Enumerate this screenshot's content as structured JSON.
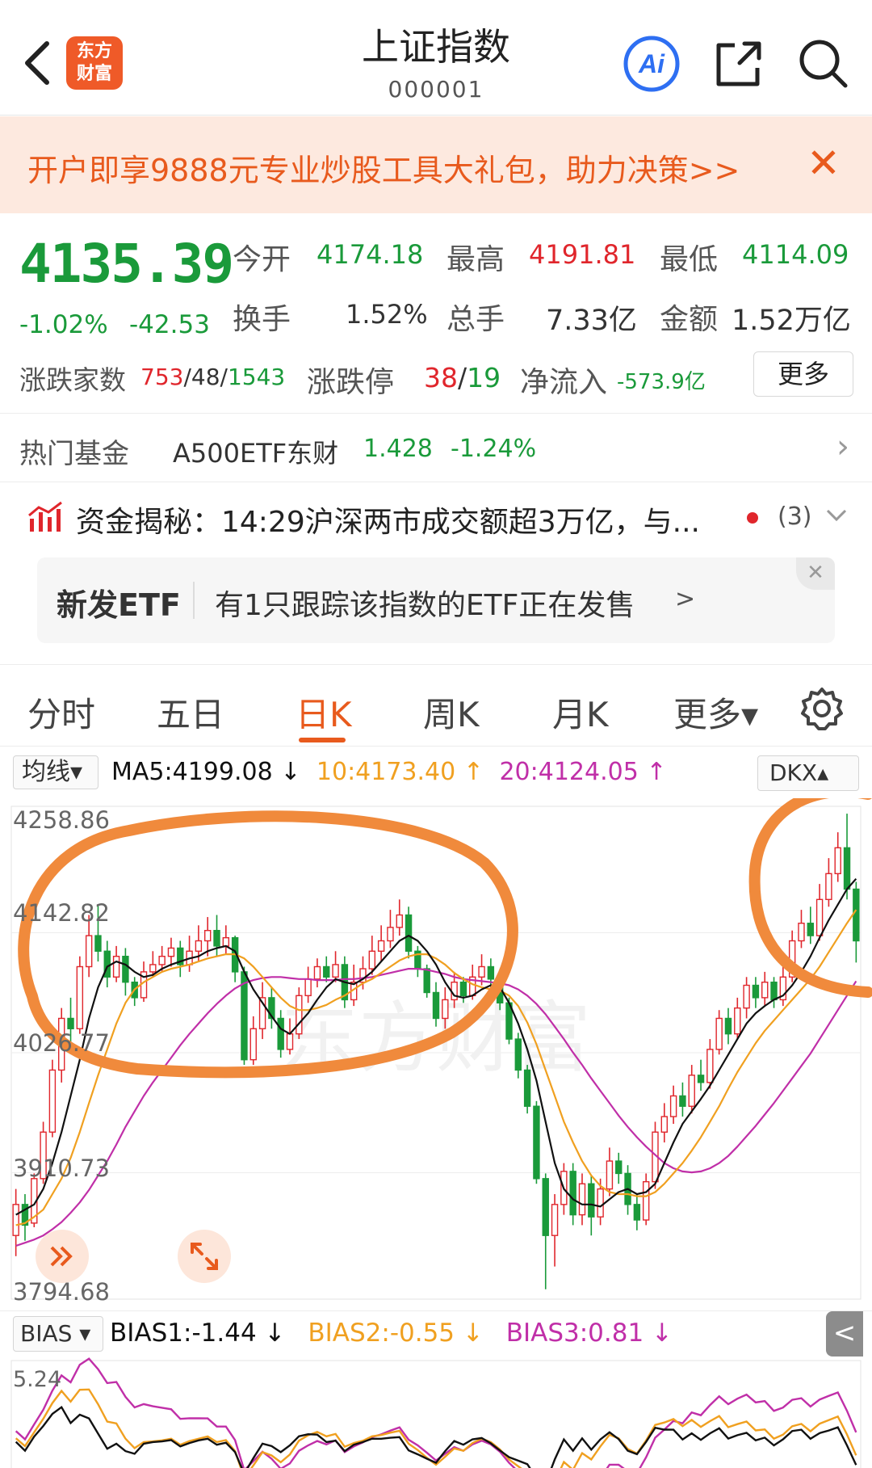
{
  "header": {
    "logo": [
      "东方",
      "财富"
    ],
    "title": "上证指数",
    "code": "000001"
  },
  "promo": {
    "text": "开户即享9888元专业炒股工具大礼包，助力决策>>",
    "close": "✕"
  },
  "quote": {
    "price": "4135.39",
    "pct": "-1.02%",
    "chg": "-42.53",
    "open_label": "今开",
    "open": "4174.18",
    "high_label": "最高",
    "high": "4191.81",
    "low_label": "最低",
    "low": "4114.09",
    "turnover_label": "换手",
    "turnover": "1.52%",
    "volume_label": "总手",
    "volume": "7.33亿",
    "amount_label": "金额",
    "amount": "1.52万亿",
    "breadth_label": "涨跌家数",
    "up": "753",
    "flat": "48",
    "down": "1543",
    "limit_label": "涨跌停",
    "limit_up": "38",
    "limit_down": "19",
    "inflow_label": "净流入",
    "inflow": "-573.9亿",
    "more": "更多"
  },
  "fund": {
    "label": "热门基金",
    "name": "A500ETF东财",
    "price": "1.428",
    "chg": "-1.24%"
  },
  "news": {
    "text": "资金揭秘：14:29沪深两市成交额超3万亿，与...",
    "count": "(3)"
  },
  "etf": {
    "tag": "新发ETF",
    "text": "有1只跟踪该指数的ETF正在发售",
    "arrow": ">",
    "close": "✕"
  },
  "tabs": [
    "分时",
    "五日",
    "日K",
    "周K",
    "月K",
    "更多▾"
  ],
  "active_tab": "日K",
  "ma": {
    "select": "均线▾",
    "ma5": "MA5:4199.08 ↓",
    "ma10": "10:4173.40 ↑",
    "ma20": "20:4124.05 ↑",
    "dk": "DKX▴"
  },
  "y_axis": [
    "4258.86",
    "4142.82",
    "4026.77",
    "3910.73",
    "3794.68"
  ],
  "bias": {
    "select": "BIAS ▾",
    "b1": "BIAS1:-1.44 ↓",
    "b2": "BIAS2:-0.55 ↓",
    "b3": "BIAS3:0.81 ↓",
    "top": "5.24",
    "collapse": "<"
  },
  "watermark": "东方财富",
  "colors": {
    "up": "#e0262c",
    "down": "#1a9a3a",
    "ma5": "#111111",
    "ma10": "#f0a020",
    "ma20": "#c02fa8",
    "accent": "#e85a1d",
    "annotation": "#f08a3c"
  },
  "chart_data": {
    "type": "candlestick",
    "y_range": [
      3794.68,
      4258.86
    ],
    "candles": [
      [
        3850,
        3880,
        3830,
        3895
      ],
      [
        3880,
        3860,
        3845,
        3890
      ],
      [
        3862,
        3905,
        3858,
        3910
      ],
      [
        3905,
        3950,
        3900,
        3960
      ],
      [
        3950,
        4010,
        3945,
        4020
      ],
      [
        4010,
        4060,
        3998,
        4070
      ],
      [
        4060,
        4050,
        4035,
        4080
      ],
      [
        4050,
        4110,
        4045,
        4120
      ],
      [
        4110,
        4140,
        4100,
        4160
      ],
      [
        4140,
        4125,
        4115,
        4170
      ],
      [
        4125,
        4100,
        4090,
        4135
      ],
      [
        4100,
        4120,
        4095,
        4130
      ],
      [
        4120,
        4095,
        4082,
        4128
      ],
      [
        4095,
        4080,
        4072,
        4100
      ],
      [
        4080,
        4105,
        4076,
        4115
      ],
      [
        4105,
        4112,
        4100,
        4125
      ],
      [
        4112,
        4120,
        4105,
        4130
      ],
      [
        4120,
        4128,
        4110,
        4138
      ],
      [
        4128,
        4112,
        4100,
        4135
      ],
      [
        4112,
        4125,
        4105,
        4140
      ],
      [
        4125,
        4135,
        4115,
        4150
      ],
      [
        4135,
        4145,
        4120,
        4158
      ],
      [
        4145,
        4130,
        4120,
        4160
      ],
      [
        4130,
        4138,
        4122,
        4150
      ],
      [
        4138,
        4105,
        4095,
        4140
      ],
      [
        4105,
        4020,
        4015,
        4110
      ],
      [
        4020,
        4050,
        4015,
        4062
      ],
      [
        4050,
        4080,
        4040,
        4095
      ],
      [
        4080,
        4060,
        4050,
        4090
      ],
      [
        4060,
        4030,
        4022,
        4068
      ],
      [
        4030,
        4045,
        4025,
        4060
      ],
      [
        4045,
        4082,
        4040,
        4090
      ],
      [
        4082,
        4098,
        4075,
        4110
      ],
      [
        4098,
        4110,
        4090,
        4118
      ],
      [
        4110,
        4100,
        4095,
        4120
      ],
      [
        4100,
        4112,
        4095,
        4125
      ],
      [
        4112,
        4078,
        4070,
        4120
      ],
      [
        4078,
        4095,
        4072,
        4112
      ],
      [
        4095,
        4108,
        4088,
        4120
      ],
      [
        4108,
        4125,
        4102,
        4140
      ],
      [
        4125,
        4135,
        4115,
        4150
      ],
      [
        4135,
        4148,
        4128,
        4165
      ],
      [
        4148,
        4160,
        4140,
        4175
      ],
      [
        4160,
        4125,
        4118,
        4168
      ],
      [
        4125,
        4108,
        4100,
        4130
      ],
      [
        4108,
        4085,
        4080,
        4112
      ],
      [
        4085,
        4060,
        4052,
        4095
      ],
      [
        4060,
        4078,
        4050,
        4090
      ],
      [
        4078,
        4095,
        4070,
        4105
      ],
      [
        4095,
        4082,
        4075,
        4100
      ],
      [
        4082,
        4100,
        4078,
        4112
      ],
      [
        4100,
        4110,
        4092,
        4122
      ],
      [
        4110,
        4098,
        4088,
        4118
      ],
      [
        4098,
        4075,
        4068,
        4102
      ],
      [
        4075,
        4040,
        4035,
        4080
      ],
      [
        4040,
        4010,
        4002,
        4046
      ],
      [
        4010,
        3975,
        3968,
        4015
      ],
      [
        3975,
        3905,
        3900,
        3980
      ],
      [
        3905,
        3850,
        3798,
        3910
      ],
      [
        3850,
        3880,
        3820,
        3890
      ],
      [
        3880,
        3912,
        3870,
        3920
      ],
      [
        3912,
        3870,
        3860,
        3920
      ],
      [
        3870,
        3900,
        3860,
        3910
      ],
      [
        3900,
        3868,
        3850,
        3908
      ],
      [
        3868,
        3895,
        3860,
        3905
      ],
      [
        3895,
        3922,
        3888,
        3935
      ],
      [
        3922,
        3910,
        3900,
        3930
      ],
      [
        3910,
        3880,
        3870,
        3918
      ],
      [
        3880,
        3865,
        3855,
        3890
      ],
      [
        3865,
        3902,
        3860,
        3910
      ],
      [
        3902,
        3950,
        3895,
        3960
      ],
      [
        3950,
        3965,
        3940,
        3978
      ],
      [
        3965,
        3985,
        3958,
        3995
      ],
      [
        3985,
        3975,
        3965,
        3998
      ],
      [
        3975,
        4005,
        3968,
        4015
      ],
      [
        4005,
        3998,
        3990,
        4020
      ],
      [
        3998,
        4030,
        3992,
        4040
      ],
      [
        4030,
        4060,
        4025,
        4068
      ],
      [
        4060,
        4045,
        4035,
        4070
      ],
      [
        4045,
        4070,
        4040,
        4080
      ],
      [
        4070,
        4092,
        4060,
        4100
      ],
      [
        4092,
        4080,
        4070,
        4100
      ],
      [
        4080,
        4095,
        4072,
        4105
      ],
      [
        4095,
        4078,
        4070,
        4100
      ],
      [
        4078,
        4100,
        4072,
        4110
      ],
      [
        4100,
        4135,
        4095,
        4145
      ],
      [
        4135,
        4152,
        4128,
        4165
      ],
      [
        4152,
        4140,
        4132,
        4168
      ],
      [
        4140,
        4175,
        4135,
        4190
      ],
      [
        4175,
        4200,
        4168,
        4215
      ],
      [
        4200,
        4225,
        4192,
        4240
      ],
      [
        4225,
        4185,
        4175,
        4258
      ],
      [
        4185,
        4135,
        4114,
        4192
      ]
    ],
    "ma5": [
      3870,
      3875,
      3880,
      3895,
      3920,
      3950,
      3985,
      4020,
      4060,
      4090,
      4110,
      4115,
      4112,
      4105,
      4100,
      4102,
      4108,
      4112,
      4115,
      4118,
      4120,
      4125,
      4128,
      4130,
      4125,
      4105,
      4088,
      4075,
      4062,
      4050,
      4045,
      4055,
      4065,
      4078,
      4090,
      4098,
      4095,
      4093,
      4098,
      4105,
      4115,
      4125,
      4135,
      4140,
      4135,
      4125,
      4112,
      4095,
      4082,
      4080,
      4082,
      4088,
      4092,
      4090,
      4075,
      4055,
      4030,
      4000,
      3960,
      3920,
      3895,
      3885,
      3880,
      3880,
      3878,
      3885,
      3892,
      3895,
      3890,
      3892,
      3900,
      3920,
      3940,
      3958,
      3970,
      3982,
      3995,
      4010,
      4025,
      4040,
      4055,
      4065,
      4072,
      4078,
      4082,
      4092,
      4105,
      4120,
      4138,
      4155,
      4170,
      4185,
      4195
    ],
    "ma10": [
      3860,
      3862,
      3868,
      3875,
      3890,
      3905,
      3925,
      3950,
      3978,
      4005,
      4030,
      4055,
      4075,
      4088,
      4095,
      4100,
      4105,
      4108,
      4110,
      4112,
      4115,
      4118,
      4120,
      4122,
      4122,
      4118,
      4110,
      4100,
      4090,
      4080,
      4072,
      4068,
      4068,
      4070,
      4073,
      4078,
      4082,
      4088,
      4094,
      4098,
      4104,
      4110,
      4116,
      4120,
      4122,
      4122,
      4118,
      4112,
      4104,
      4098,
      4093,
      4090,
      4088,
      4087,
      4082,
      4072,
      4056,
      4035,
      4010,
      3985,
      3960,
      3940,
      3922,
      3908,
      3898,
      3892,
      3890,
      3890,
      3888,
      3888,
      3892,
      3900,
      3910,
      3920,
      3932,
      3945,
      3960,
      3975,
      3992,
      4008,
      4022,
      4036,
      4048,
      4058,
      4068,
      4078,
      4088,
      4098,
      4110,
      4124,
      4138,
      4152,
      4165
    ],
    "ma20": [
      3840,
      3843,
      3846,
      3850,
      3856,
      3863,
      3872,
      3882,
      3894,
      3908,
      3922,
      3938,
      3955,
      3970,
      3985,
      3998,
      4010,
      4022,
      4034,
      4045,
      4055,
      4065,
      4074,
      4082,
      4089,
      4094,
      4097,
      4099,
      4100,
      4100,
      4099,
      4098,
      4098,
      4097,
      4097,
      4097,
      4098,
      4098,
      4099,
      4100,
      4102,
      4104,
      4106,
      4108,
      4108,
      4107,
      4105,
      4103,
      4100,
      4098,
      4097,
      4096,
      4095,
      4094,
      4092,
      4088,
      4082,
      4074,
      4064,
      4052,
      4040,
      4027,
      4015,
      4002,
      3990,
      3978,
      3966,
      3955,
      3945,
      3936,
      3928,
      3920,
      3915,
      3912,
      3911,
      3912,
      3915,
      3920,
      3927,
      3936,
      3946,
      3956,
      3967,
      3978,
      3990,
      4002,
      4014,
      4026,
      4040,
      4054,
      4068,
      4082,
      4096
    ]
  }
}
